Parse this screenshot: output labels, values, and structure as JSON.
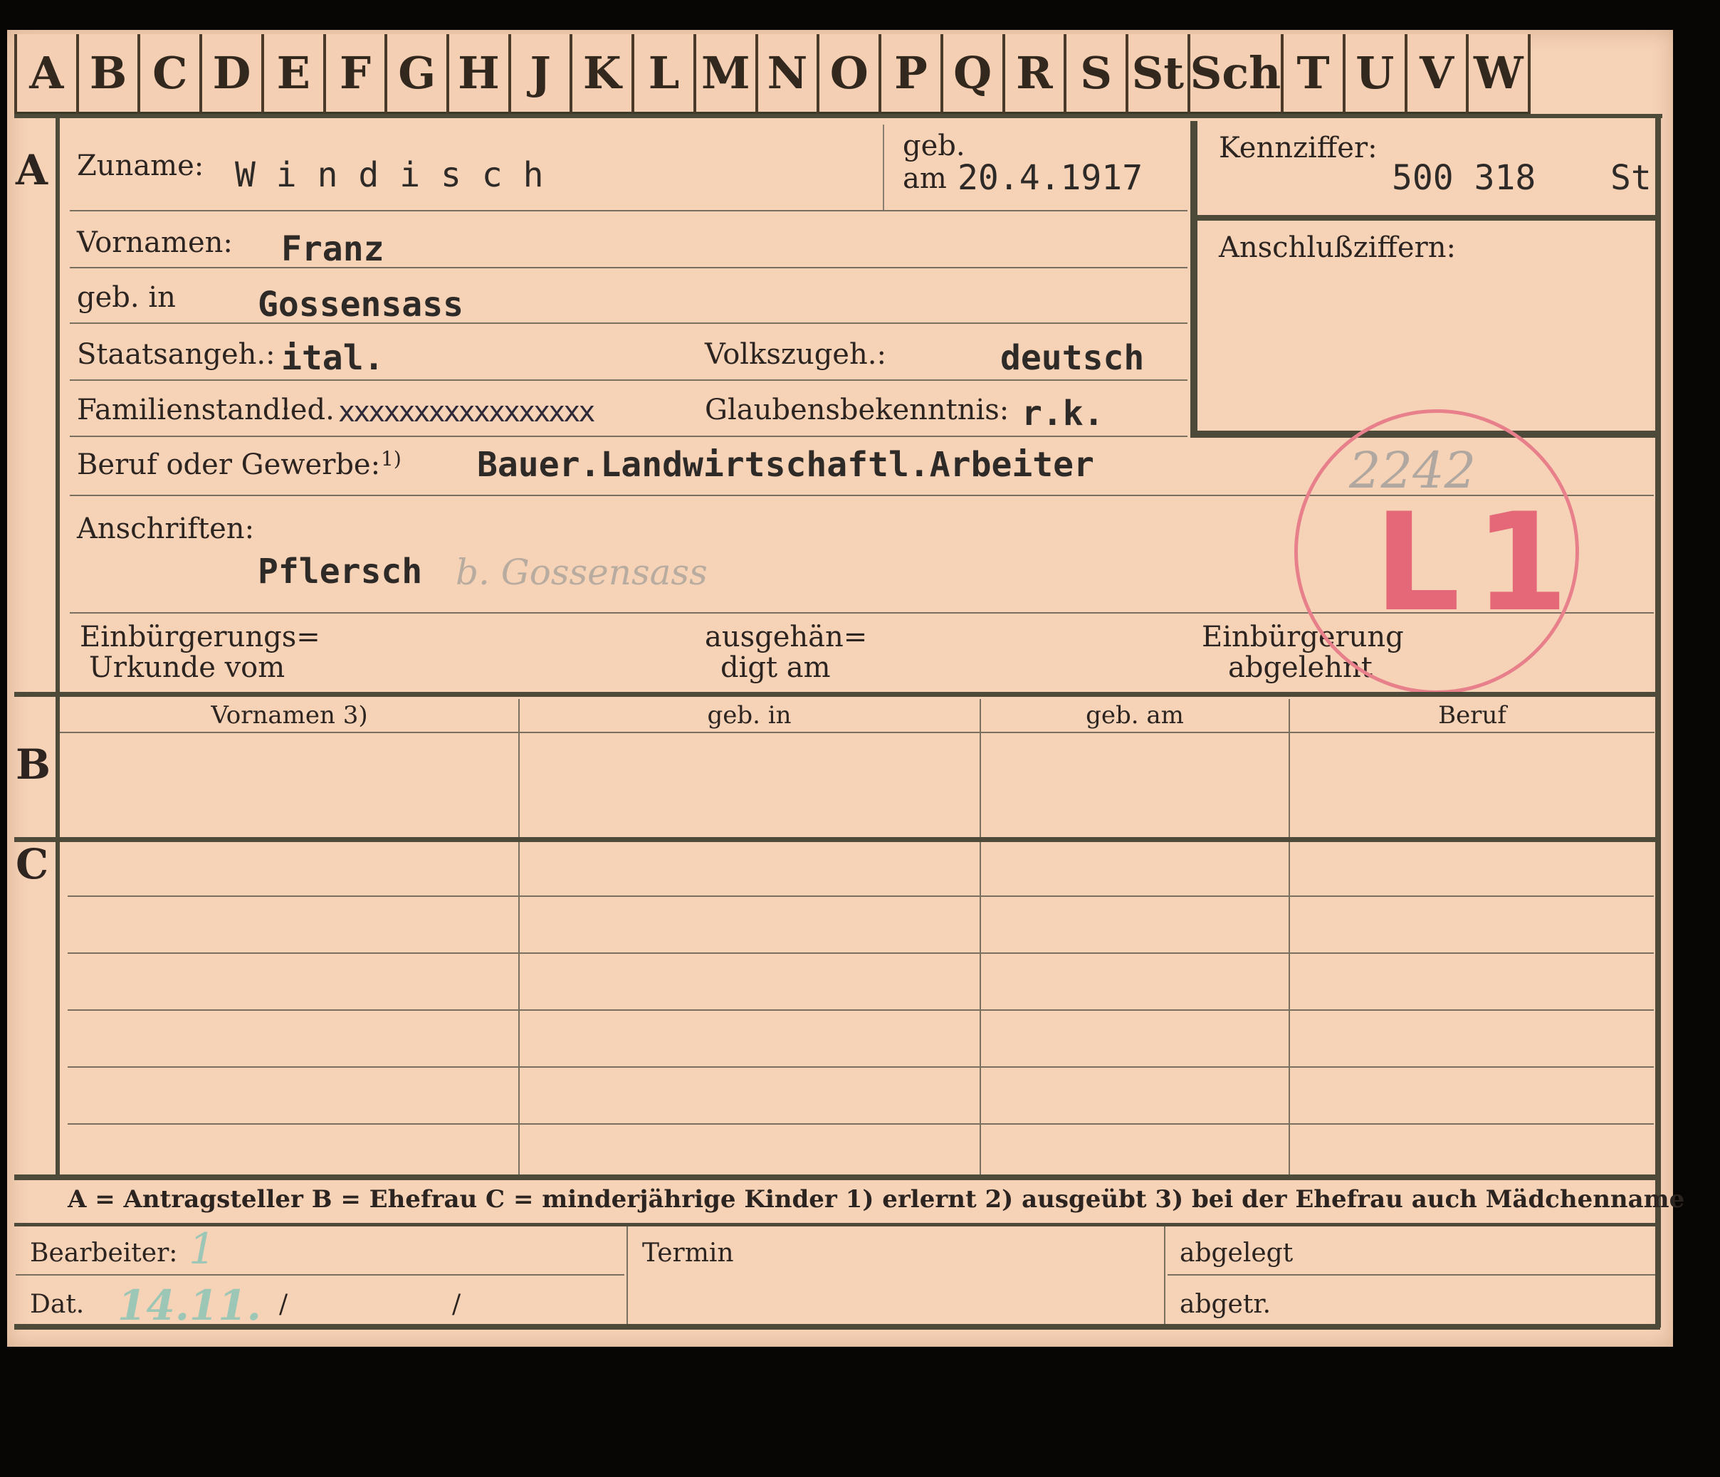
{
  "tabs": [
    "A",
    "B",
    "C",
    "D",
    "E",
    "F",
    "G",
    "H",
    "J",
    "K",
    "L",
    "M",
    "N",
    "O",
    "P",
    "Q",
    "R",
    "S",
    "St",
    "Sch",
    "T",
    "U",
    "V",
    "W"
  ],
  "section_letters": {
    "a": "A",
    "b": "B",
    "c": "C"
  },
  "labels": {
    "zuname": "Zuname:",
    "geb": "geb.",
    "am": "am",
    "kennziffer": "Kennziffer:",
    "anschlussziffern": "Anschlußziffern:",
    "vornamen": "Vornamen:",
    "geb_in": "geb. in",
    "staatsangeh": "Staatsangeh.:",
    "volkszugeh": "Volkszugeh.:",
    "familienstand": "Familienstand:",
    "familienstand_pre": "led.",
    "glaubensbekenntnis": "Glaubensbekenntnis:",
    "beruf": "Beruf oder Gewerbe:",
    "beruf_note": "1)",
    "anschriften": "Anschriften:",
    "einb_urkunde_1": "Einbürgerungs=",
    "einb_urkunde_2": "Urkunde vom",
    "ausgeh_1": "ausgehän=",
    "ausgeh_2": "digt am",
    "einb_abgelehnt_1": "Einbürgerung",
    "einb_abgelehnt_2": "abgelehnt"
  },
  "values": {
    "zuname": "W i n d i s c h",
    "geb_am": "20.4.1917",
    "kennziffer": "500 318",
    "kennziffer_suffix": "St",
    "vornamen": "Franz",
    "geb_in": "Gossensass",
    "staatsangeh": "ital.",
    "volkszugeh": "deutsch",
    "familienstand_struck": "xxxxxxxxxxxxxxxxx",
    "glaubensbekenntnis": "r.k.",
    "beruf": "Bauer.Landwirtschaftl.Arbeiter",
    "anschrift": "Pflersch",
    "anschrift_hw": "b. Gossensass"
  },
  "stamp": {
    "number": "2242",
    "code": "L1",
    "color": "#e46878"
  },
  "table_headers": [
    "Vornamen 3)",
    "geb. in",
    "geb. am",
    "Beruf"
  ],
  "legend": "A = Antragsteller   B = Ehefrau   C = minderjährige Kinder   1) erlernt   2) ausgeübt   3) bei der Ehefrau auch Mädchenname",
  "footer": {
    "bearbeiter": "Bearbeiter:",
    "bearbeiter_hw": "1",
    "dat": "Dat.",
    "dat_hw": "14.11.",
    "slash1": "/",
    "slash2": "/",
    "termin": "Termin",
    "abgelegt": "abgelegt",
    "abgetr": "abgetr."
  }
}
